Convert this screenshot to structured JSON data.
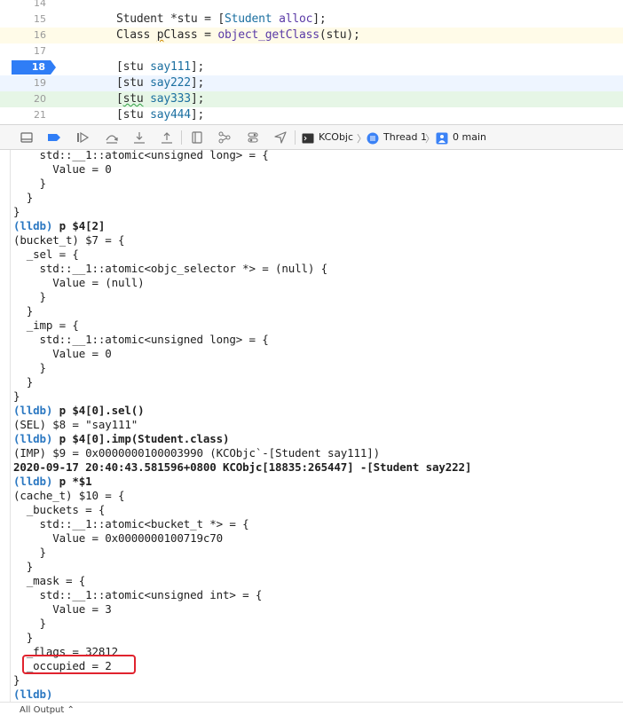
{
  "editor": {
    "lines": [
      {
        "num": "14",
        "plain": ""
      },
      {
        "num": "15",
        "parts": [
          {
            "t": "Student *stu = [",
            "c": ""
          },
          {
            "t": "Student",
            "c": "ty"
          },
          {
            "t": " ",
            "c": ""
          },
          {
            "t": "alloc",
            "c": "kw"
          },
          {
            "t": "];",
            "c": ""
          }
        ]
      },
      {
        "num": "16",
        "parts": [
          {
            "t": "Class ",
            "c": ""
          },
          {
            "t": "p",
            "c": "underp"
          },
          {
            "t": "Class = ",
            "c": ""
          },
          {
            "t": "object_getClass",
            "c": "kw"
          },
          {
            "t": "(stu);",
            "c": ""
          }
        ]
      },
      {
        "num": "17",
        "plain": ""
      },
      {
        "num": "18",
        "parts": [
          {
            "t": "[stu ",
            "c": ""
          },
          {
            "t": "say111",
            "c": "ty"
          },
          {
            "t": "];",
            "c": ""
          }
        ]
      },
      {
        "num": "19",
        "parts": [
          {
            "t": "[stu ",
            "c": ""
          },
          {
            "t": "say222",
            "c": "ty"
          },
          {
            "t": "];",
            "c": ""
          }
        ]
      },
      {
        "num": "20",
        "parts": [
          {
            "t": "[",
            "c": ""
          },
          {
            "t": "stu",
            "c": "under"
          },
          {
            "t": " ",
            "c": ""
          },
          {
            "t": "say333",
            "c": "ty"
          },
          {
            "t": "];",
            "c": ""
          }
        ]
      },
      {
        "num": "21",
        "parts": [
          {
            "t": "[stu ",
            "c": ""
          },
          {
            "t": "say444",
            "c": "ty"
          },
          {
            "t": "];",
            "c": ""
          }
        ]
      }
    ],
    "breakpoint_line": "18"
  },
  "debugbar": {
    "buttons": [
      "hide-debug-area-icon",
      "breakpoints-toggle-icon",
      "continue-icon",
      "step-over-icon",
      "step-into-icon",
      "step-out-icon",
      "view-debugger-icon",
      "memory-graph-icon",
      "environment-overrides-icon",
      "simulate-location-icon"
    ],
    "breadcrumb": {
      "target": "KCObjc",
      "thread": "Thread 1",
      "frame": "0 main"
    }
  },
  "console": {
    "lines": [
      {
        "t": "    std::__1::atomic<unsigned long> = {"
      },
      {
        "t": "      Value = 0"
      },
      {
        "t": "    }"
      },
      {
        "t": "  }"
      },
      {
        "t": "}"
      },
      {
        "p": "(lldb)",
        "t": " p $4[2]"
      },
      {
        "t": "(bucket_t) $7 = {"
      },
      {
        "t": "  _sel = {"
      },
      {
        "t": "    std::__1::atomic<objc_selector *> = (null) {"
      },
      {
        "t": "      Value = (null)"
      },
      {
        "t": "    }"
      },
      {
        "t": "  }"
      },
      {
        "t": "  _imp = {"
      },
      {
        "t": "    std::__1::atomic<unsigned long> = {"
      },
      {
        "t": "      Value = 0"
      },
      {
        "t": "    }"
      },
      {
        "t": "  }"
      },
      {
        "t": "}"
      },
      {
        "p": "(lldb)",
        "t": " p $4[0].sel()"
      },
      {
        "t": "(SEL) $8 = \"say111\""
      },
      {
        "p": "(lldb)",
        "t": " p $4[0].imp(Student.class)"
      },
      {
        "t": "(IMP) $9 = 0x0000000100003990 (KCObjc`-[Student say111])"
      },
      {
        "b": "2020-09-17 20:40:43.581596+0800 KCObjc[18835:265447] -[Student say222]"
      },
      {
        "p": "(lldb)",
        "t": " p *$1"
      },
      {
        "t": "(cache_t) $10 = {"
      },
      {
        "t": "  _buckets = {"
      },
      {
        "t": "    std::__1::atomic<bucket_t *> = {"
      },
      {
        "t": "      Value = 0x0000000100719c70"
      },
      {
        "t": "    }"
      },
      {
        "t": "  }"
      },
      {
        "t": "  _mask = {"
      },
      {
        "t": "    std::__1::atomic<unsigned int> = {"
      },
      {
        "t": "      Value = 3"
      },
      {
        "t": "    }"
      },
      {
        "t": "  }"
      },
      {
        "t": "  _flags = 32812"
      },
      {
        "t": "  _occupied = 2"
      },
      {
        "t": "}"
      },
      {
        "p": "(lldb)",
        "t": ""
      }
    ]
  },
  "bottombar": {
    "output_filter": "All Output ⌃"
  },
  "colors": {
    "breakpoint": "#2f7df6",
    "line19_bg": "#eef5ff",
    "line20_bg": "#e6f6e6",
    "highlight_box": "#e0232e",
    "prompt": "#2b78c2"
  }
}
